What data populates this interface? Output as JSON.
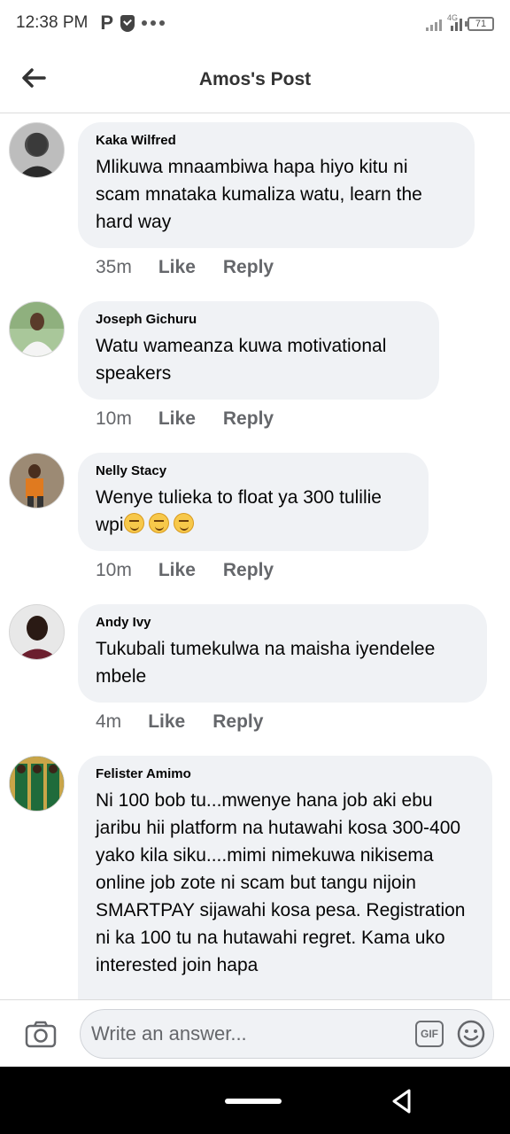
{
  "status_bar": {
    "time": "12:38 PM",
    "app_letter": "P",
    "network": "4G",
    "battery": "71"
  },
  "header": {
    "title": "Amos's Post"
  },
  "comments": [
    {
      "author": "Kaka Wilfred",
      "text": "Mlikuwa mnaambiwa hapa hiyo kitu ni scam mnataka kumaliza watu, learn the hard way",
      "time": "35m",
      "like_label": "Like",
      "reply_label": "Reply"
    },
    {
      "author": "Joseph Gichuru",
      "text": "Watu wameanza kuwa motivational speakers",
      "time": "10m",
      "like_label": "Like",
      "reply_label": "Reply"
    },
    {
      "author": "Nelly Stacy",
      "text": "Wenye tulieka to float ya 300 tulilie wpi",
      "time": "10m",
      "like_label": "Like",
      "reply_label": "Reply"
    },
    {
      "author": "Andy Ivy",
      "text": "Tukubali tumekulwa na maisha iyendelee mbele",
      "time": "4m",
      "like_label": "Like",
      "reply_label": "Reply"
    },
    {
      "author": "Felister Amimo",
      "text": "Ni 100 bob tu...mwenye hana job aki ebu jaribu hii platform na hutawahi kosa 300-400 yako kila siku....mimi nimekuwa nikisema online job zote ni scam but tangu nijoin SMARTPAY sijawahi kosa pesa. Registration ni ka 100 tu na hutawahi regret. Kama uko interested join hapa"
    }
  ],
  "composer": {
    "placeholder": "Write an answer...",
    "gif_label": "GIF"
  }
}
